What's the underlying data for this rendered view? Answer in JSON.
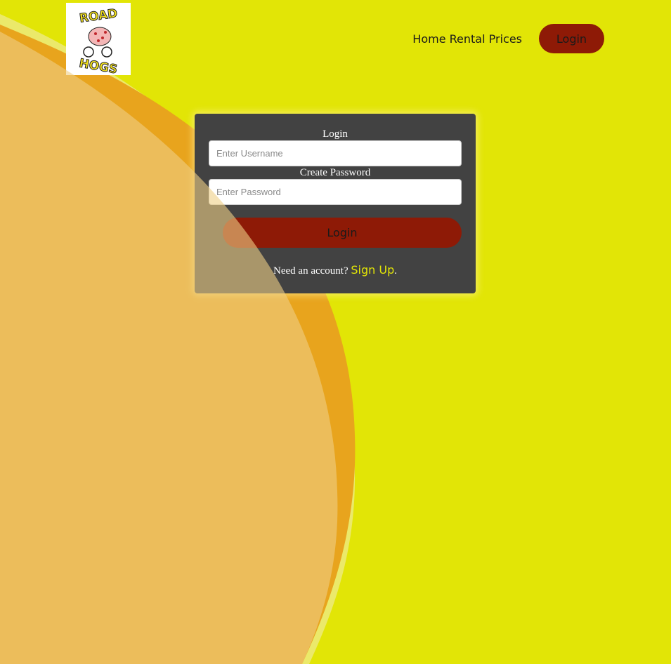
{
  "logo": {
    "line1": "ROAD",
    "line2": "HOGS"
  },
  "nav": {
    "link_label": "Home Rental Prices",
    "login_label": "Login"
  },
  "form": {
    "username_label": "Login",
    "username_placeholder": "Enter Username",
    "password_label": "Create Password",
    "password_placeholder": "Enter Password",
    "submit_label": "Login",
    "signup_prompt": "Need an account?",
    "signup_link": "Sign Up",
    "signup_suffix": "."
  },
  "colors": {
    "background": "#e2e506",
    "accent_button": "#8e1a06",
    "card": "#424242",
    "wave_peach": "#eecf85",
    "wave_orange": "#e8a41d"
  }
}
